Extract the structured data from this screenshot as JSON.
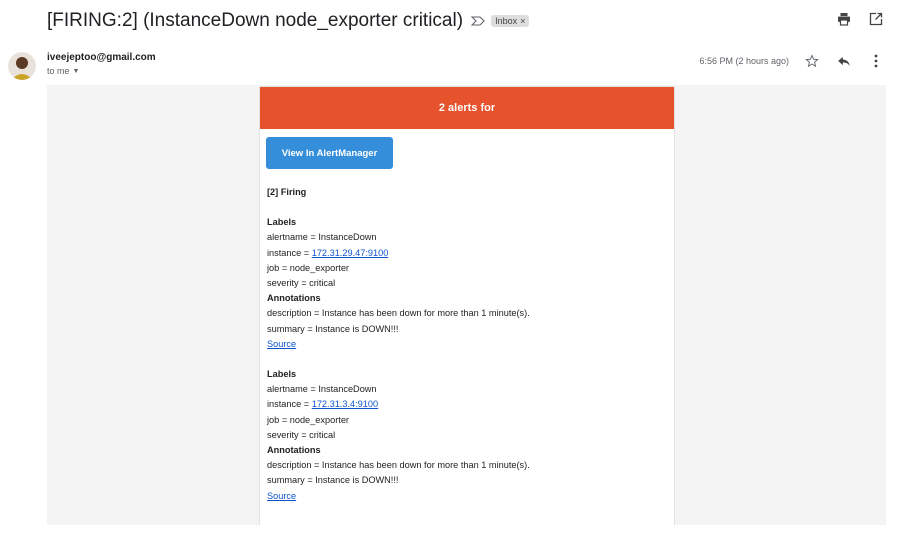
{
  "email": {
    "subject": "[FIRING:2] (InstanceDown node_exporter critical)",
    "label": "Inbox",
    "sender": "iveejeptoo@gmail.com",
    "recipient": "to me",
    "timestamp": "6:56 PM (2 hours ago)"
  },
  "icons": {
    "importance": "importance-marker-icon",
    "label_remove": "close-icon",
    "print": "print-icon",
    "open_new_window": "open-in-new-window-icon",
    "star": "star-icon",
    "reply": "reply-icon",
    "more": "more-vert-icon",
    "caret": "chevron-down-icon"
  },
  "alert": {
    "header": "2 alerts for",
    "button_label": "View In AlertManager",
    "firing_heading": "[2] Firing",
    "colors": {
      "header_bg": "#e6522c",
      "button_bg": "#348eda"
    },
    "alerts": [
      {
        "labels_heading": "Labels",
        "alertname": "alertname = InstanceDown",
        "instance_prefix": "instance = ",
        "instance_link": "172.31.29.47:9100",
        "job": "job = node_exporter",
        "severity": "severity = critical",
        "annotations_heading": "Annotations",
        "description": "description = Instance has been down for more than 1 minute(s).",
        "summary": "summary = Instance is DOWN!!!",
        "source_link": "Source"
      },
      {
        "labels_heading": "Labels",
        "alertname": "alertname = InstanceDown",
        "instance_prefix": "instance = ",
        "instance_link": "172.31.3.4:9100",
        "job": "job = node_exporter",
        "severity": "severity = critical",
        "annotations_heading": "Annotations",
        "description": "description = Instance has been down for more than 1 minute(s).",
        "summary": "summary = Instance is DOWN!!!",
        "source_link": "Source"
      }
    ]
  }
}
